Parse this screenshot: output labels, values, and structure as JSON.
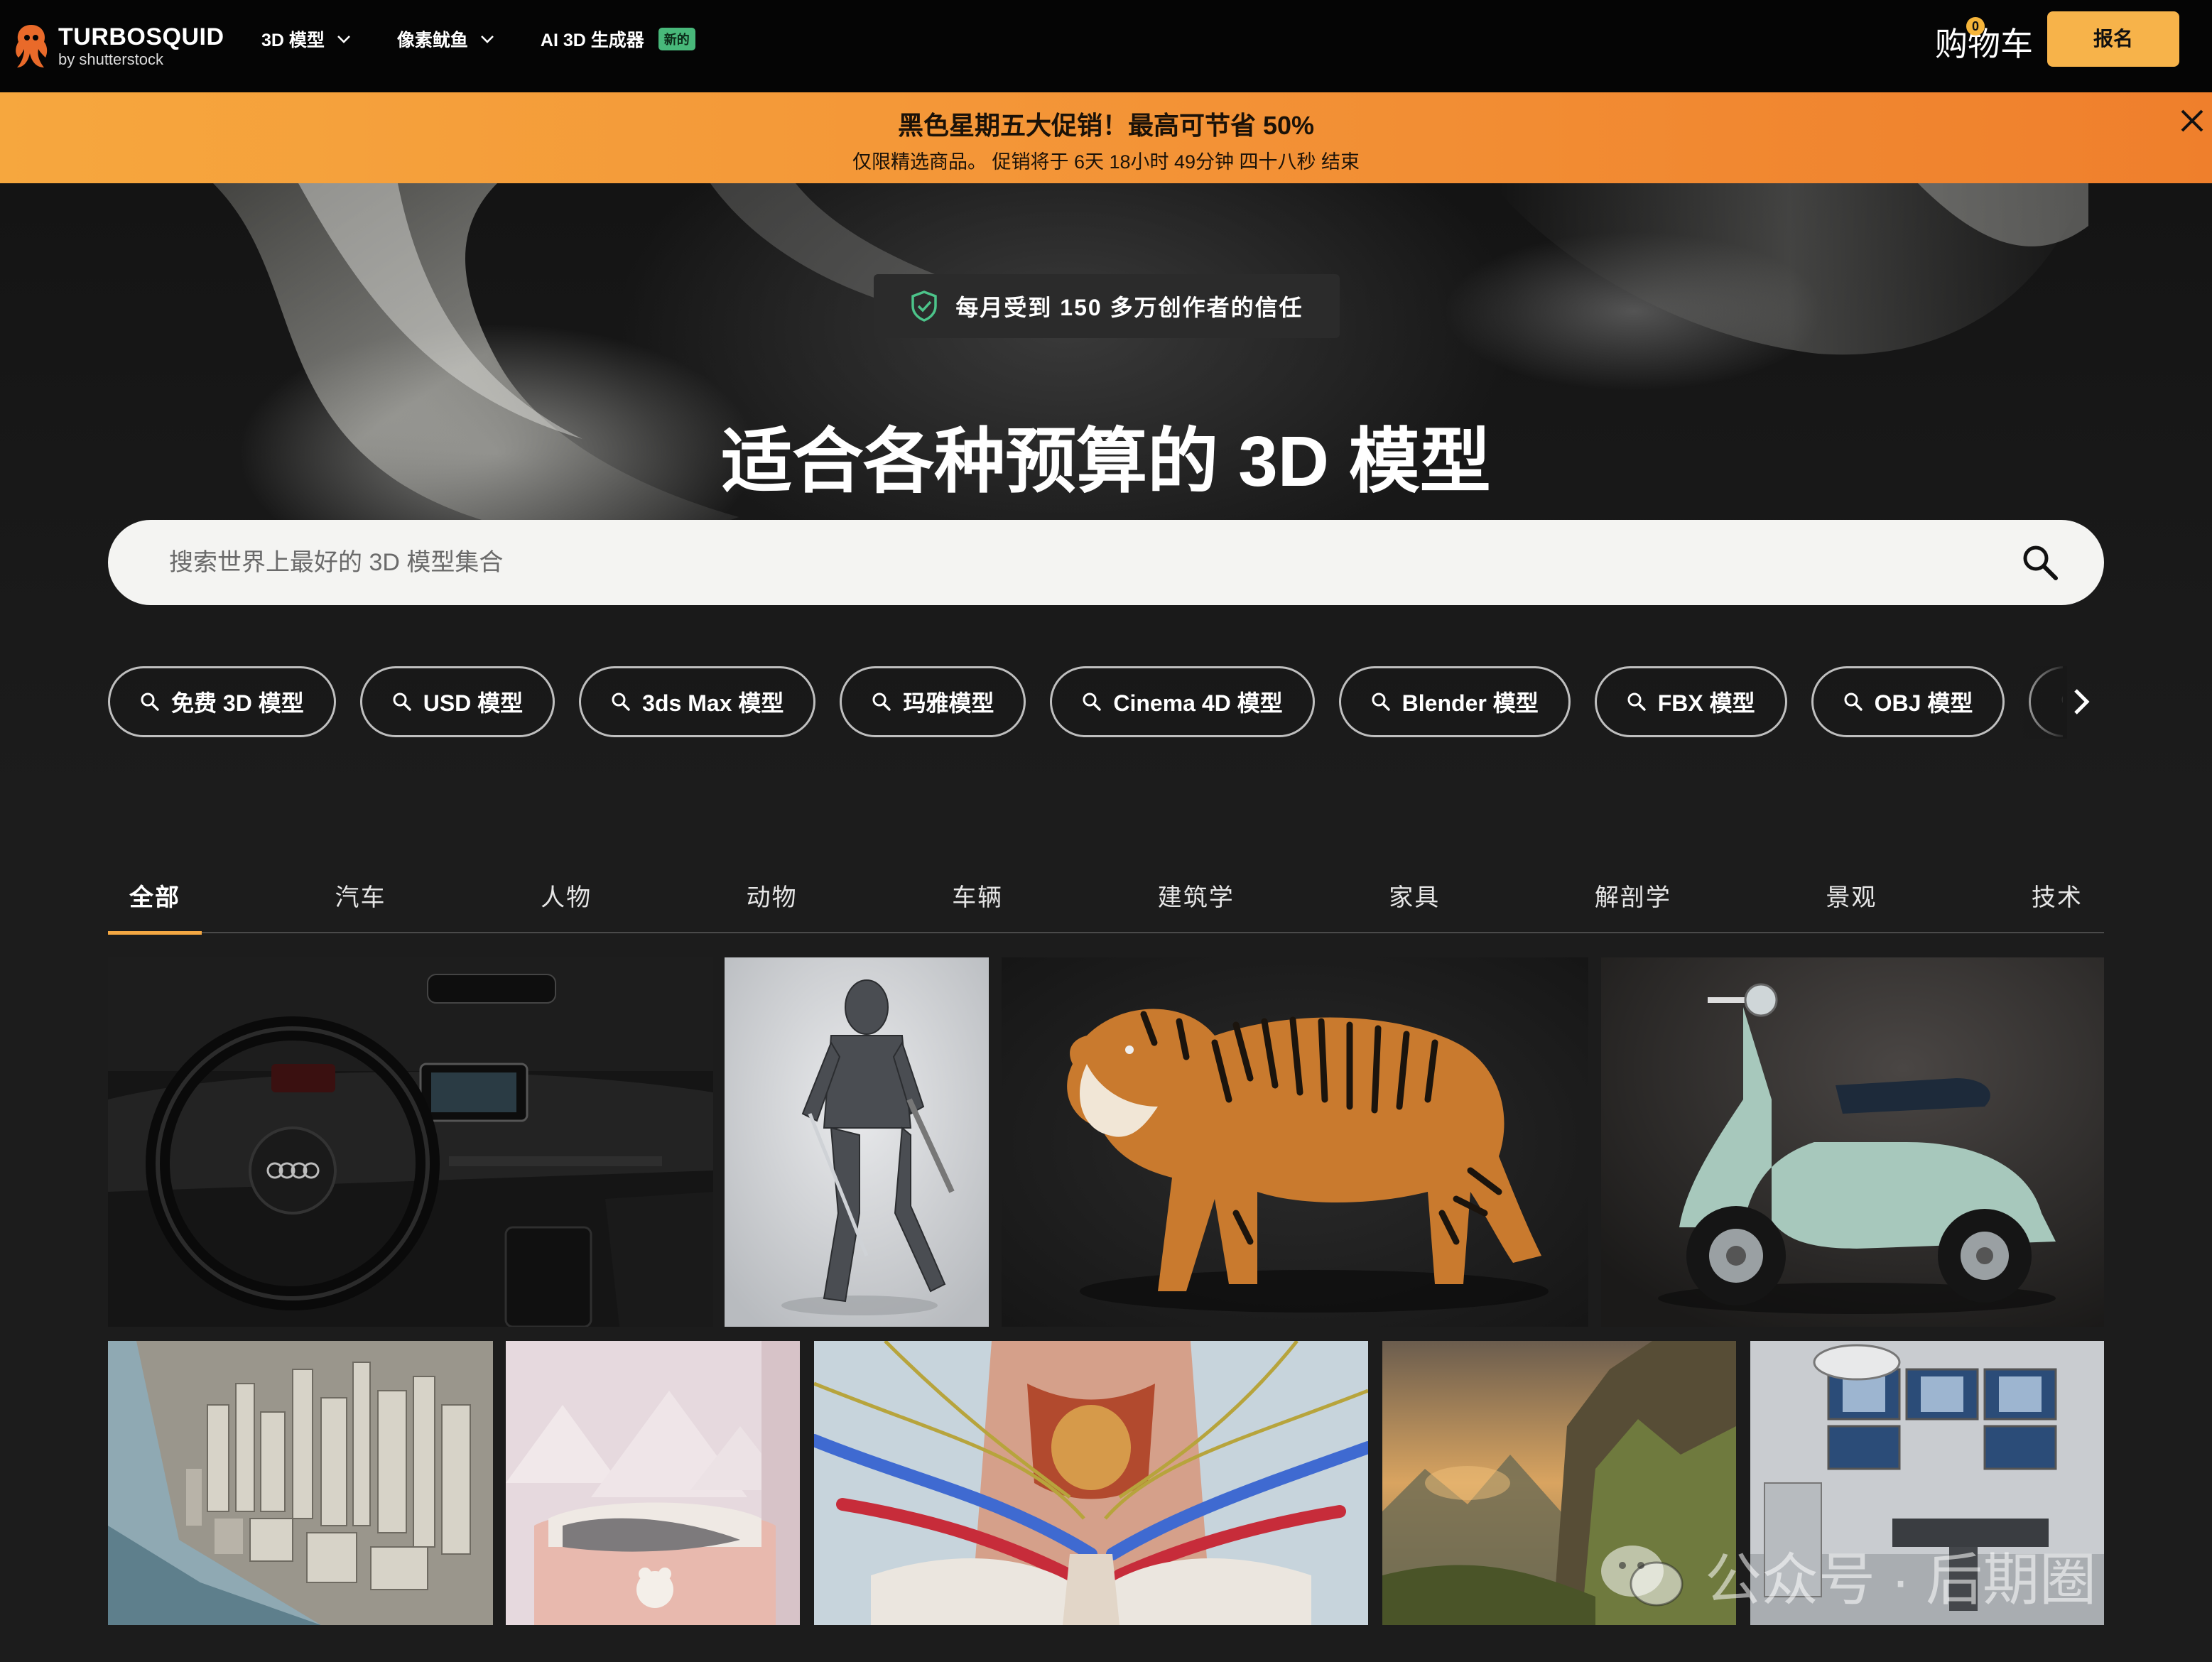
{
  "nav": {
    "logo_main": "TURBOSQUID",
    "logo_sub": "by shutterstock",
    "menu": [
      {
        "label": "3D 模型",
        "has_dropdown": true
      },
      {
        "label": "像素鱿鱼",
        "has_dropdown": true
      },
      {
        "label": "AI 3D 生成器",
        "has_dropdown": false,
        "badge": "新的"
      }
    ],
    "cart_label": "购物车",
    "cart_count": "0",
    "signup_label": "报名"
  },
  "promo": {
    "title": "黑色星期五大促销！最高可节省 50%",
    "subtitle": "仅限精选商品。 促销将于 6天 18小时 49分钟 四十八秒 结束"
  },
  "hero": {
    "trust_text": "每月受到 150 多万创作者的信任",
    "title": "适合各种预算的 3D 模型",
    "search_placeholder": "搜索世界上最好的 3D 模型集合"
  },
  "chips": [
    "免费 3D 模型",
    "USD 模型",
    "3ds Max 模型",
    "玛雅模型",
    "Cinema 4D 模型",
    "Blender 模型",
    "FBX 模型",
    "OBJ 模型",
    ""
  ],
  "tabs": [
    "全部",
    "汽车",
    "人物",
    "动物",
    "车辆",
    "建筑学",
    "家具",
    "解剖学",
    "景观",
    "技术"
  ],
  "active_tab": "全部",
  "gallery": [
    {
      "subject": "car-interior"
    },
    {
      "subject": "knight-armor"
    },
    {
      "subject": "tiger"
    },
    {
      "subject": "scooter"
    },
    {
      "subject": "city-aerial"
    },
    {
      "subject": "pink-bedroom"
    },
    {
      "subject": "anatomy-neck"
    },
    {
      "subject": "mountain-landscape"
    },
    {
      "subject": "operating-room"
    }
  ],
  "watermark": {
    "text": "公众号 · 后期圈"
  },
  "colors": {
    "accent": "#f3a742",
    "promo": "#f39236",
    "signup": "#f7b34a",
    "new_badge": "#48b87a",
    "shield": "#4cc48a"
  }
}
